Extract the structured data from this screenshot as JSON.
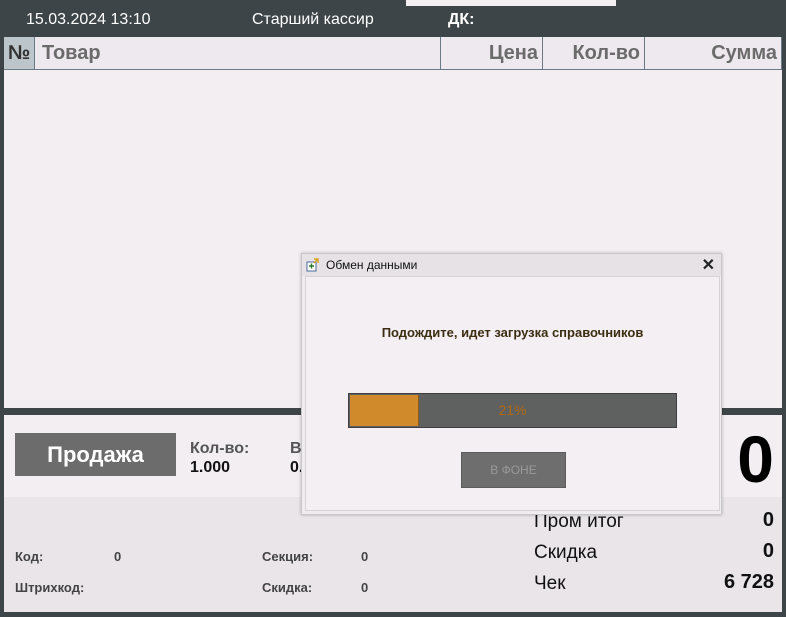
{
  "topbar": {
    "datetime": "15.03.2024 13:10",
    "role": "Старший кассир",
    "dk_label": "ДК:"
  },
  "table": {
    "headers": {
      "num": "№",
      "name": "Товар",
      "price": "Цена",
      "qty": "Кол-во",
      "sum": "Сумма"
    }
  },
  "bottom": {
    "mode_button": "Продажа",
    "qty_label": "Кол-во:",
    "qty_value": "1.000",
    "weight_label": "В",
    "weight_value": "0.",
    "big_total": "0",
    "code_label": "Код:",
    "code_value": "0",
    "barcode_label": "Штрихкод:",
    "barcode_value": "",
    "section_label": "Секция:",
    "section_value": "0",
    "discount_small_label": "Скидка:",
    "discount_small_value": "0",
    "totals": [
      {
        "label": "Пром итог",
        "value": "0"
      },
      {
        "label": "Скидка",
        "value": "0"
      },
      {
        "label": "Чек",
        "value": "6 728"
      }
    ]
  },
  "dialog": {
    "title": "Обмен данными",
    "close_glyph": "✕",
    "icon": "data-exchange-icon",
    "message": "Подождите, идет загрузка справочников",
    "progress_percent": 21,
    "progress_label": "21%",
    "background_button": "В ФОНЕ"
  }
}
